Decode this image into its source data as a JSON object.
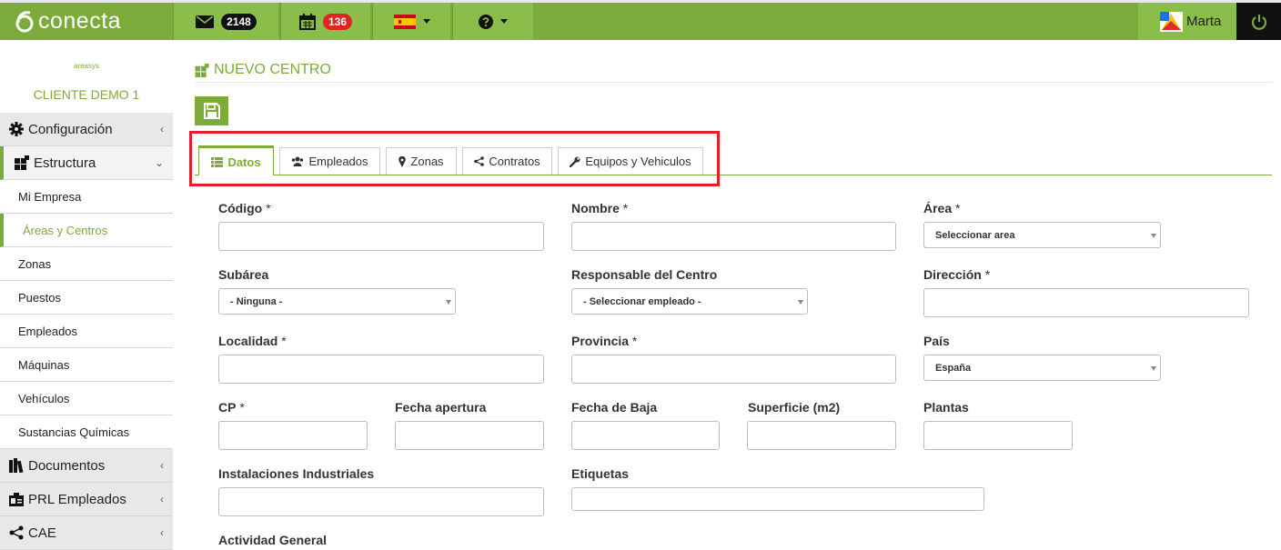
{
  "topbar": {
    "logo_text": "conecta",
    "mail_count": "2148",
    "calendar_count": "136",
    "user_name": "Marta"
  },
  "sidebar": {
    "brand": "areasys",
    "client": "CLIENTE DEMO 1",
    "items": [
      {
        "label": "Configuración"
      },
      {
        "label": "Estructura"
      },
      {
        "label": "Mi Empresa"
      },
      {
        "label": "Áreas y Centros"
      },
      {
        "label": "Zonas"
      },
      {
        "label": "Puestos"
      },
      {
        "label": "Empleados"
      },
      {
        "label": "Máquinas"
      },
      {
        "label": "Vehículos"
      },
      {
        "label": "Sustancias Químicas"
      },
      {
        "label": "Documentos"
      },
      {
        "label": "PRL Empleados"
      },
      {
        "label": "CAE"
      }
    ]
  },
  "main": {
    "title": "NUEVO CENTRO",
    "tabs": [
      {
        "label": "Datos"
      },
      {
        "label": "Empleados"
      },
      {
        "label": "Zonas"
      },
      {
        "label": "Contratos"
      },
      {
        "label": "Equipos y Vehiculos"
      }
    ],
    "fields": {
      "codigo": "Código",
      "nombre": "Nombre",
      "area": "Área",
      "subarea": "Subárea",
      "responsable": "Responsable del Centro",
      "direccion": "Dirección",
      "localidad": "Localidad",
      "provincia": "Provincia",
      "pais": "País",
      "cp": "CP",
      "fecha_apertura": "Fecha apertura",
      "fecha_baja": "Fecha de Baja",
      "superficie": "Superficie (m2)",
      "plantas": "Plantas",
      "instalaciones": "Instalaciones Industriales",
      "etiquetas": "Etiquetas",
      "actividad": "Actividad General"
    },
    "required_mark": " *",
    "selects": {
      "area": "Seleccionar area",
      "subarea": "- Ninguna -",
      "responsable": "- Seleccionar empleado -",
      "pais": "España"
    }
  },
  "colors": {
    "brand_green": "#7cab3b",
    "highlight_red": "#e3202c"
  }
}
